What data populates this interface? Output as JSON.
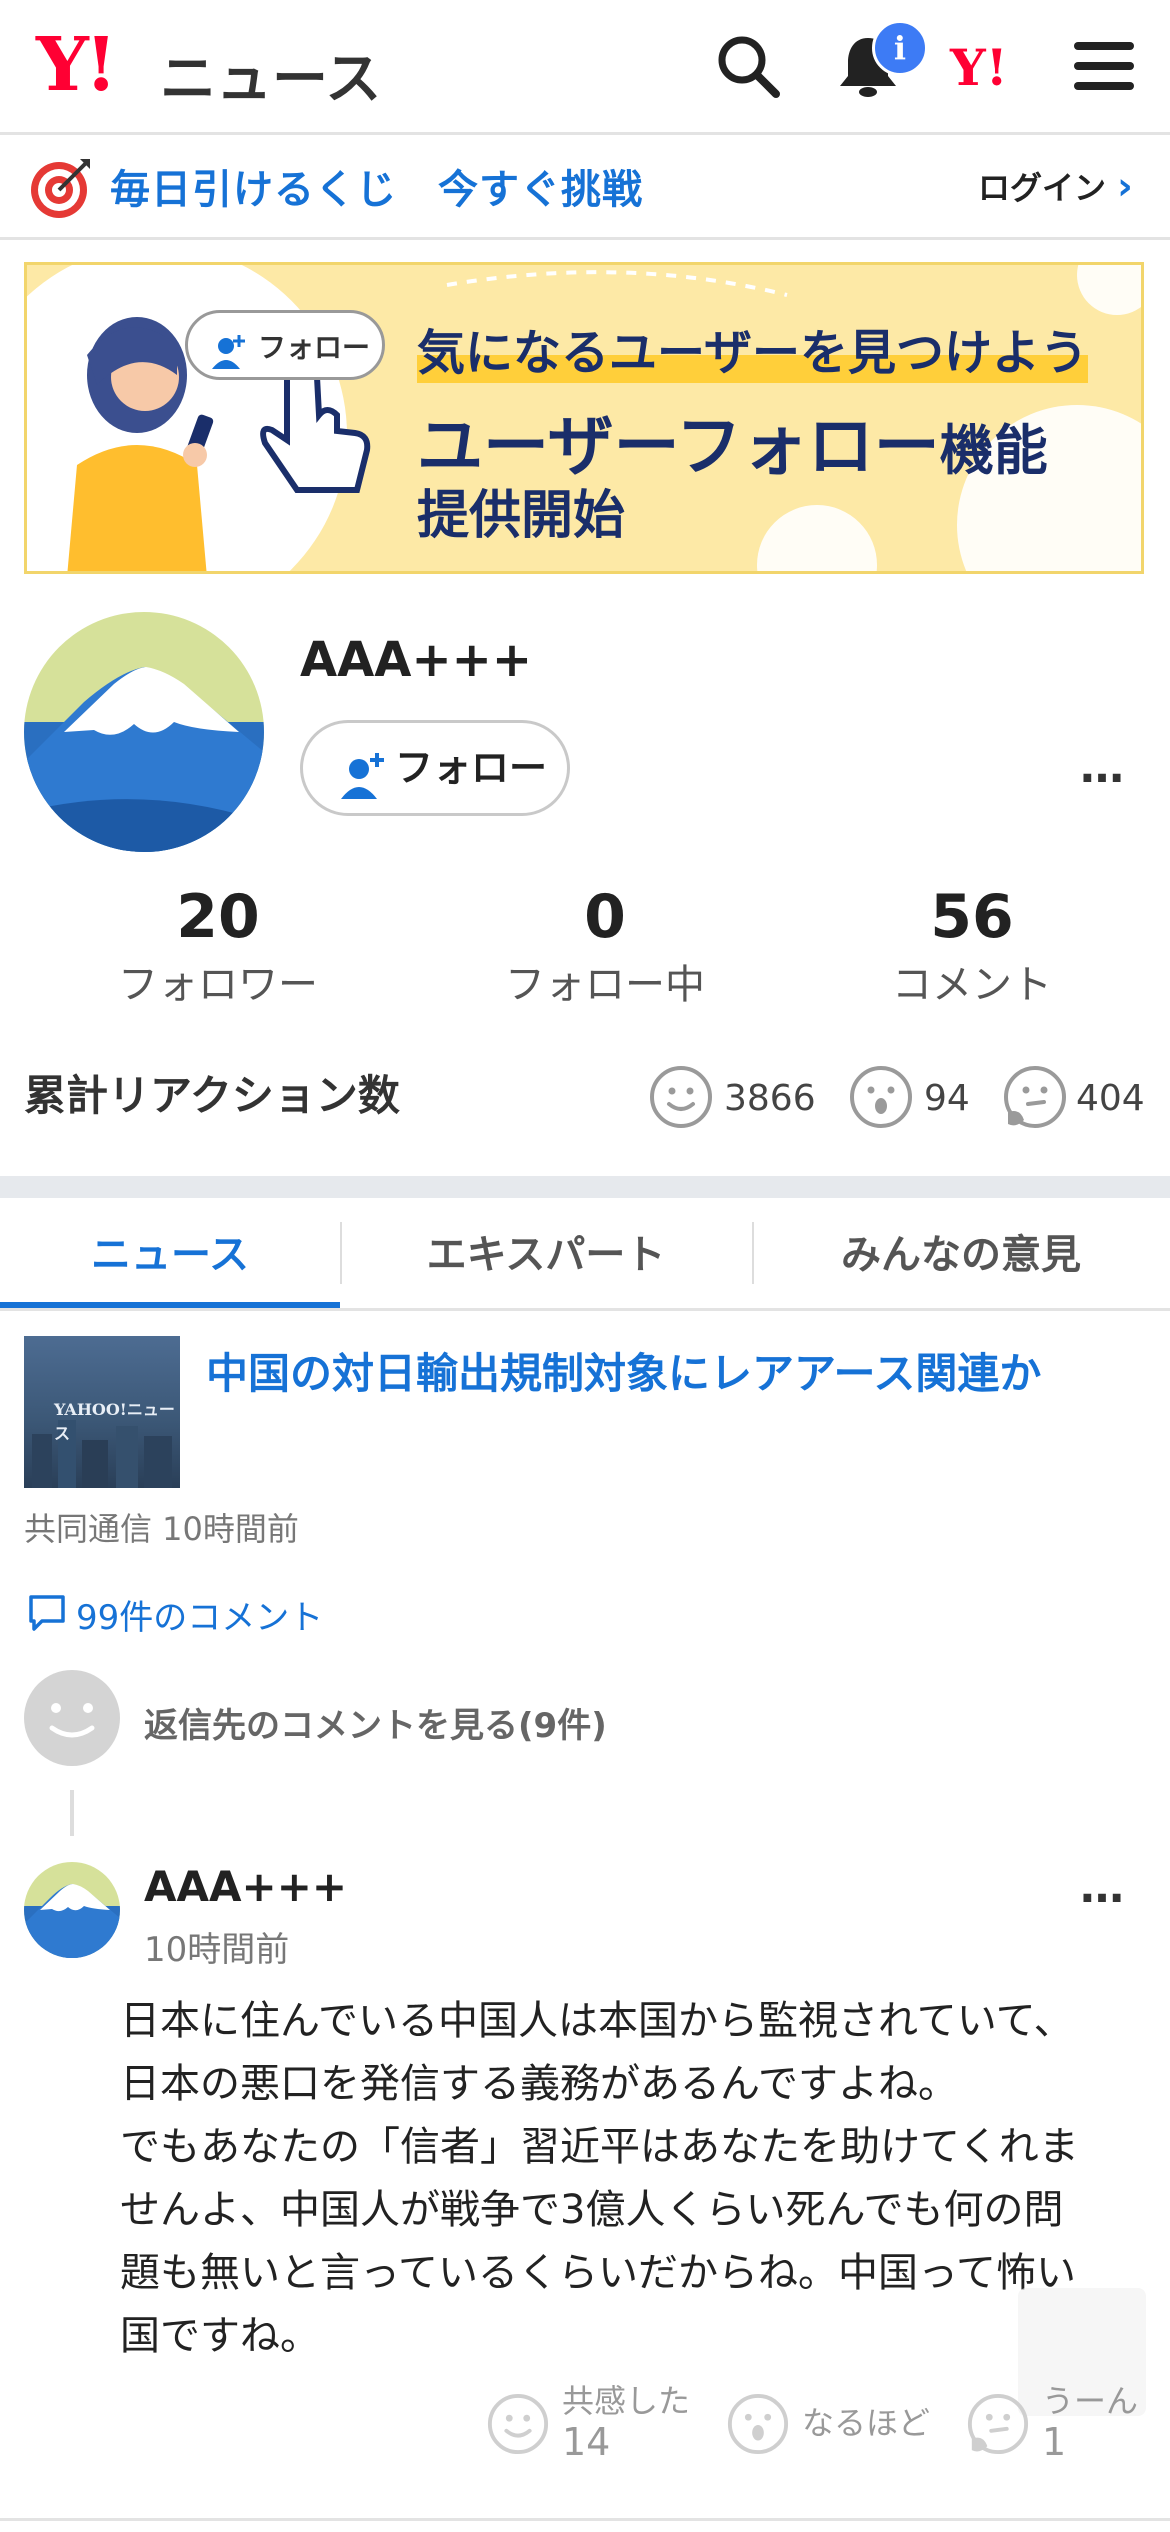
{
  "header": {
    "logo_mark": "Y!",
    "logo_text": "ニュース",
    "notification_badge": "i",
    "yahoo_mark": "Y!"
  },
  "promo": {
    "text": "毎日引けるくじ　今すぐ挑戦",
    "login": "ログイン"
  },
  "banner": {
    "follow_pill": "フォロー",
    "line1": "気になるユーザーを見つけよう",
    "line2_main": "ユーザーフォロー",
    "line2_suffix": "機能",
    "line3": "提供開始"
  },
  "profile": {
    "username": "AAA+++",
    "follow_button": "フォロー",
    "more": "…",
    "stats": [
      {
        "value": "20",
        "label": "フォロワー"
      },
      {
        "value": "0",
        "label": "フォロー中"
      },
      {
        "value": "56",
        "label": "コメント"
      }
    ],
    "reactions_title": "累計リアクション数",
    "reactions": [
      {
        "icon": "smile-icon",
        "count": "3866"
      },
      {
        "icon": "surprised-icon",
        "count": "94"
      },
      {
        "icon": "thinking-icon",
        "count": "404"
      }
    ]
  },
  "tabs": [
    {
      "label": "ニュース",
      "active": true
    },
    {
      "label": "エキスパート",
      "active": false
    },
    {
      "label": "みんなの意見",
      "active": false
    }
  ],
  "article": {
    "thumb_text": "YAHOO!ニュース",
    "title": "中国の対日輸出規制対象にレアアース関連か",
    "source": "共同通信 10時間前",
    "comments_link": "99件のコメント",
    "reply_link": "返信先のコメントを見る(9件)"
  },
  "comment": {
    "user": "AAA+++",
    "time": "10時間前",
    "more": "…",
    "body": "日本に住んでいる中国人は本国から監視されていて、\n日本の悪口を発信する義務があるんですよね。\nでもあなたの「信者」習近平はあなたを助けてくれま\nせんよ、中国人が戦争で3億人くらい死んでも何の問\n題も無いと言っているくらいだからね。中国って怖い\n国ですね。",
    "reactions": [
      {
        "icon": "smile-icon",
        "label": "共感した",
        "count": "14"
      },
      {
        "icon": "surprised-icon",
        "label": "なるほど",
        "count": ""
      },
      {
        "icon": "thinking-icon",
        "label": "うーん",
        "count": "1"
      }
    ]
  },
  "colors": {
    "accent": "#1672d6",
    "brand_red": "#ff0033",
    "banner_bg": "#fde9a6"
  }
}
